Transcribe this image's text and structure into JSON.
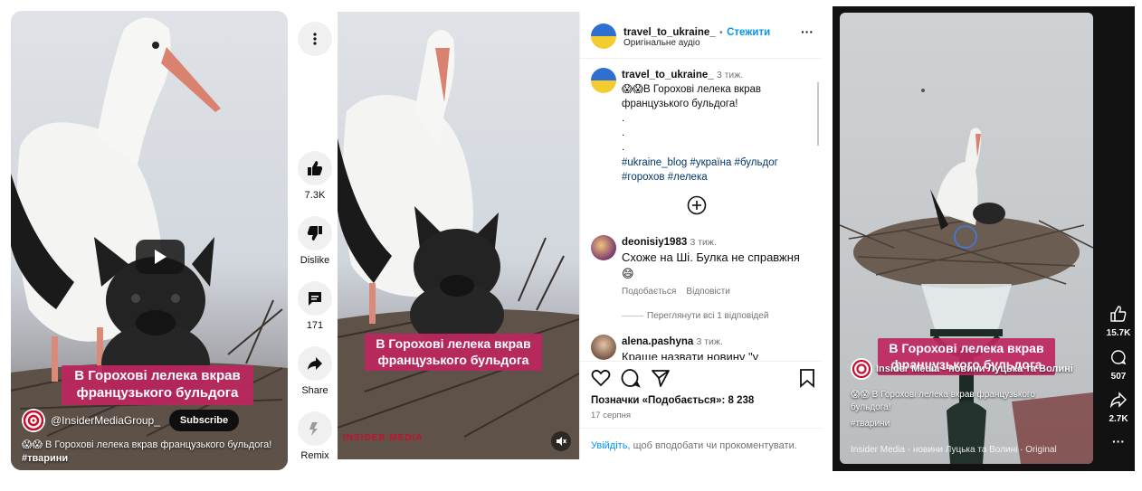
{
  "youtube": {
    "overlay_caption_line1": "В Горохові лелека вкрав",
    "overlay_caption_line2": "французького бульдога",
    "channel": "@InsiderMediaGroup_",
    "subscribe_label": "Subscribe",
    "description_emoji": "😱😱",
    "description": "В Горохові лелека вкрав французького бульдога!",
    "hashtag": "#тварини",
    "actions": {
      "like_count": "7.3K",
      "dislike_label": "Dislike",
      "comments_count": "171",
      "share_label": "Share",
      "remix_label": "Remix"
    }
  },
  "instagram": {
    "overlay_caption_line1": "В Горохові лелека вкрав",
    "overlay_caption_line2": "французького бульдога",
    "watermark": "INSIDER MEDIA",
    "header": {
      "username": "travel_to_ukraine_",
      "separator": "•",
      "follow_label": "Стежити",
      "audio": "Оригінальне аудіо",
      "more": "···"
    },
    "post": {
      "username": "travel_to_ukraine_",
      "age": "3 тиж.",
      "emoji": "😱😱",
      "text": "В Горохові лелека вкрав французького бульдога!",
      "dots": ".",
      "hashtags_line1": "#ukraine_blog #україна #бульдог",
      "hashtags_line2": "#горохов #лелека"
    },
    "comments": [
      {
        "username": "deonisiy1983",
        "age": "3 тиж.",
        "text": "Схоже на Ші. Булка не справжня 😄",
        "like_label": "Подобається",
        "reply_label": "Відповісти",
        "view_replies": "Переглянути всі 1 відповідей"
      },
      {
        "username": "alena.pashyna",
        "age": "3 тиж.",
        "text": "Краще назвати новину \"у"
      }
    ],
    "likes_text": "Позначки «Подобається»: 8 238",
    "date": "17 серпня",
    "login_link": "Увійдіть,",
    "login_text": "щоб вподобати чи прокоментувати."
  },
  "tiktok": {
    "overlay_caption_line1": "В Горохові лелека вкрав",
    "overlay_caption_line2": "французького бульдога",
    "channel": "Insider Media - новини Луцька та Волині",
    "description_emoji": "😱😱",
    "description": "В Горохові лелека вкрав французького бульдога!",
    "hashtag": "#тварини",
    "sound": "Insider Media - новини Луцька та Волині · Original",
    "likes": "15.7K",
    "comments": "507",
    "shares": "2.7K",
    "more": "···"
  },
  "colors": {
    "caption_bg": "#be2660",
    "ig_blue": "#0095f6",
    "ig_hashtag": "#00376b"
  }
}
